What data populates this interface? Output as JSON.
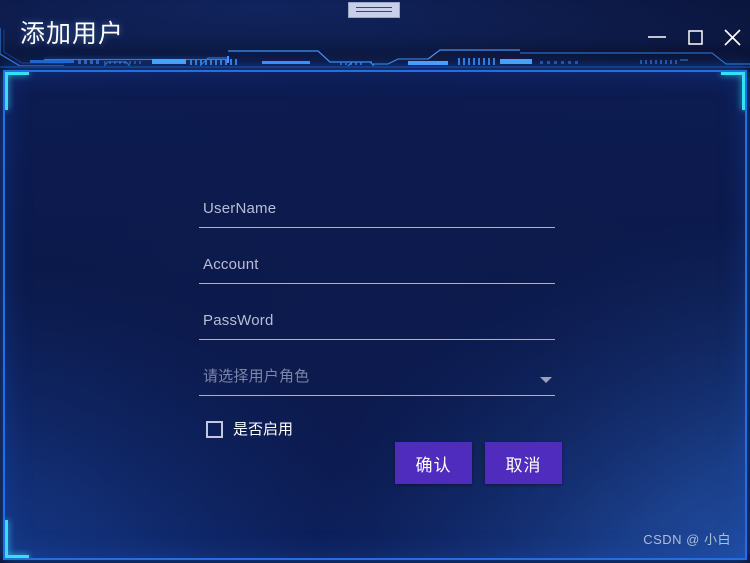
{
  "window": {
    "title": "添加用户",
    "controls": {
      "minimize_label": "—",
      "maximize_label": "□",
      "close_label": "✕"
    }
  },
  "theme": {
    "header_bg": "#0c1740",
    "content_bg": "#0b1848",
    "border_glow": "#1f6fe8",
    "corner_accent": "#35e0f5",
    "button_purple": "#4f2cbd",
    "underline": "#aab0cc",
    "label_text": "#b9bed6",
    "placeholder_text": "#7d85a8"
  },
  "form": {
    "fields": [
      {
        "name": "username",
        "text": "UserName",
        "value": "",
        "placeholder": "UserName",
        "muted": false
      },
      {
        "name": "account",
        "text": "Account",
        "value": "",
        "placeholder": "Account",
        "muted": false
      },
      {
        "name": "password",
        "text": "PassWord",
        "value": "",
        "placeholder": "PassWord",
        "muted": false
      }
    ],
    "role_select": {
      "placeholder": "请选择用户角色",
      "selected": "",
      "options": []
    },
    "enable_checkbox": {
      "label": "是否启用",
      "checked": false
    }
  },
  "buttons": {
    "confirm": "确认",
    "cancel": "取消"
  },
  "watermark": "CSDN @ 小白"
}
